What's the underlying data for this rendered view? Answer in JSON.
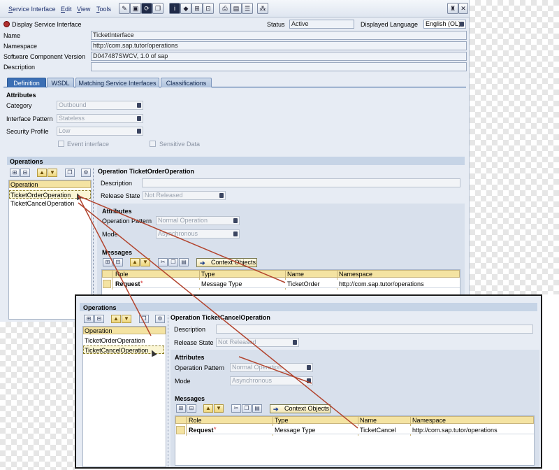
{
  "menu": {
    "service_interface": "Service Interface",
    "edit": "Edit",
    "view": "View",
    "tools": "Tools"
  },
  "header": {
    "title": "Display Service Interface",
    "status_label": "Status",
    "status_value": "Active",
    "language_label": "Displayed Language",
    "language_value": "English (OL)"
  },
  "props": {
    "name_label": "Name",
    "name_value": "TicketInterface",
    "namespace_label": "Namespace",
    "namespace_value": "http://com.sap.tutor/operations",
    "swcv_label": "Software Component Version",
    "swcv_value": "D047487SWCV, 1.0 of sap",
    "description_label": "Description",
    "description_value": ""
  },
  "tabs": [
    "Definition",
    "WSDL",
    "Matching Service Interfaces",
    "Classifications"
  ],
  "attributes": {
    "heading": "Attributes",
    "category_label": "Category",
    "category_value": "Outbound",
    "pattern_label": "Interface Pattern",
    "pattern_value": "Stateless",
    "security_label": "Security Profile",
    "security_value": "Low",
    "event_label": "Event interface",
    "sensitive_label": "Sensitive Data"
  },
  "operations": {
    "heading": "Operations",
    "column": "Operation",
    "items": [
      "TicketOrderOperation",
      "TicketCancelOperation"
    ]
  },
  "main_detail": {
    "title": "Operation TicketOrderOperation",
    "description_label": "Description",
    "release_label": "Release State",
    "release_value": "Not Released",
    "attributes_heading": "Attributes",
    "op_pattern_label": "Operation Pattern",
    "op_pattern_value": "Normal Operation",
    "mode_label": "Mode",
    "mode_value": "Asynchronous",
    "messages_heading": "Messages",
    "context_button": "Context Objects",
    "columns": [
      "Role",
      "Type",
      "Name",
      "Namespace"
    ],
    "row": {
      "role": "Request",
      "required": "*",
      "type": "Message Type",
      "name": "TicketOrder",
      "namespace": "http://com.sap.tutor/operations"
    }
  },
  "inset": {
    "ops_heading": "Operations",
    "column": "Operation",
    "items": [
      "TicketOrderOperation",
      "TicketCancelOperation"
    ],
    "title": "Operation TicketCancelOperation",
    "description_label": "Description",
    "release_label": "Release State",
    "release_value": "Not Released",
    "attributes_heading": "Attributes",
    "op_pattern_label": "Operation Pattern",
    "op_pattern_value": "Normal Operation",
    "mode_label": "Mode",
    "mode_value": "Asynchronous",
    "messages_heading": "Messages",
    "context_button": "Context Objects",
    "columns": [
      "Role",
      "Type",
      "Name",
      "Namespace"
    ],
    "row": {
      "role": "Request",
      "required": "*",
      "type": "Message Type",
      "name": "TicketCancel",
      "namespace": "http://com.sap.tutor/operations"
    }
  },
  "colors": {
    "annotation_line": "#b2442e",
    "tab_active": "#3c6fb4",
    "grid_header": "#f4e3a2"
  }
}
